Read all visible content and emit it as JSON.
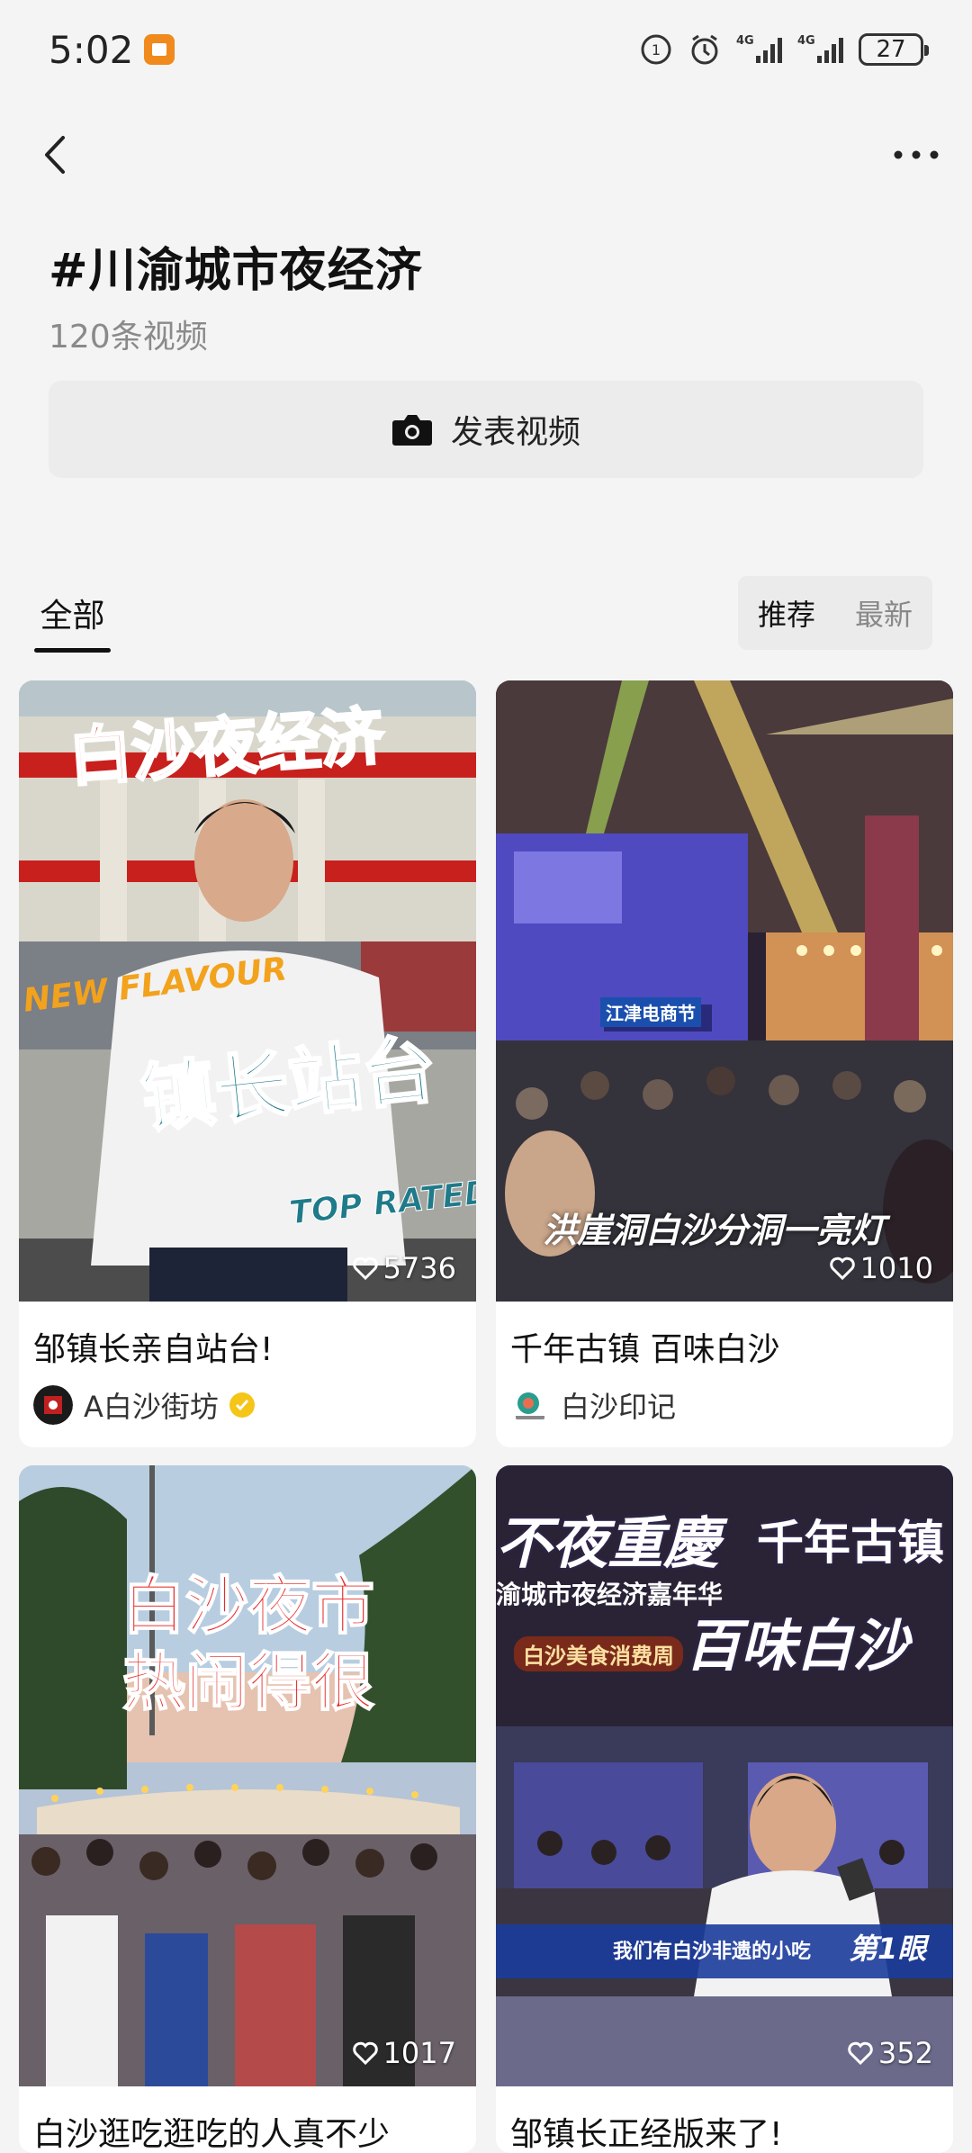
{
  "status": {
    "time": "5:02",
    "battery": "27",
    "signal_labels": [
      "4G",
      "4G"
    ]
  },
  "nav": {
    "back_icon": "chevron-left-icon",
    "more_icon": "more-dots-icon"
  },
  "header": {
    "title": "#川渝城市夜经济",
    "count": "120条视频"
  },
  "publish": {
    "label": "发表视频",
    "icon": "camera-icon"
  },
  "tabs": {
    "all": "全部"
  },
  "sort": {
    "recommend": "推荐",
    "latest": "最新"
  },
  "cards": [
    {
      "title": "邹镇长亲自站台!",
      "likes": "5736",
      "author": "A白沙街坊",
      "verified": true,
      "overlay": [
        "白沙夜经济",
        "NEW FLAVOUR",
        "镇长站台",
        "TOP RATED"
      ]
    },
    {
      "title": "千年古镇  百味白沙",
      "likes": "1010",
      "author": "白沙印记",
      "verified": false,
      "overlay": [
        "洪崖洞白沙分洞一亮灯",
        "江津电商节"
      ]
    },
    {
      "title": "白沙逛吃逛吃的人真不少",
      "likes": "1017",
      "overlay": [
        "白沙夜市",
        "热闹得很"
      ]
    },
    {
      "title": "邹镇长正经版来了!",
      "likes": "352",
      "overlay": [
        "不夜重慶",
        "千年古镇",
        "渝城市夜经济嘉年华",
        "百味白沙",
        "白沙美食消费周",
        "我们有白沙非遗的小吃",
        "第1眼"
      ]
    }
  ],
  "colors": {
    "accent_red": "#d62020",
    "gold": "#f5c518",
    "teal_text": "#1f7a8a"
  }
}
